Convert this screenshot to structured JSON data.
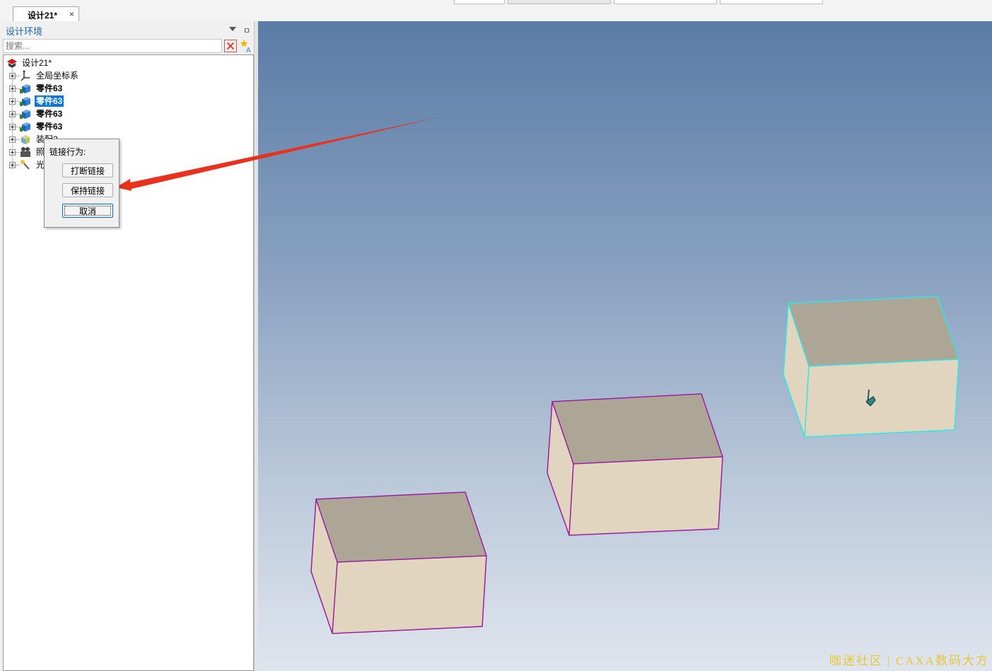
{
  "document_tab": {
    "label": "设计21*",
    "close": "×"
  },
  "panel": {
    "title": "设计环境",
    "search_placeholder": "搜索...",
    "tree": [
      {
        "label": "设计21*",
        "icon": "design-root-icon",
        "bold": false,
        "selected": false,
        "expandable": false
      },
      {
        "label": "全局坐标系",
        "icon": "coordinate-system-icon",
        "bold": false,
        "selected": false,
        "expandable": true
      },
      {
        "label": "零件63",
        "icon": "part-icon",
        "bold": true,
        "selected": false,
        "expandable": true
      },
      {
        "label": "零件63",
        "icon": "part-icon",
        "bold": true,
        "selected": true,
        "expandable": true
      },
      {
        "label": "零件63",
        "icon": "part-icon",
        "bold": true,
        "selected": false,
        "expandable": true
      },
      {
        "label": "零件63",
        "icon": "part-icon",
        "bold": true,
        "selected": false,
        "expandable": true
      },
      {
        "label": "装配2",
        "icon": "assembly-icon",
        "bold": false,
        "selected": false,
        "expandable": true
      },
      {
        "label": "照",
        "icon": "camera-icon",
        "bold": false,
        "selected": false,
        "expandable": true
      },
      {
        "label": "光",
        "icon": "light-icon",
        "bold": false,
        "selected": false,
        "expandable": true
      }
    ]
  },
  "popup": {
    "title": "链接行为:",
    "buttons": [
      "打断链接",
      "保持链接",
      "取消"
    ]
  },
  "watermark": "咖迷社区 | CAXA数码大方",
  "colors": {
    "selection": "#0b78d7",
    "panel_title": "#1e63b8",
    "arrow": "#e8321e",
    "box_outline": "#9b1fa0",
    "box_selected_outline": "#2fe6e6",
    "box_top": "#ada697",
    "box_side": "#e1d5bf",
    "watermark": "#e8c63a"
  }
}
